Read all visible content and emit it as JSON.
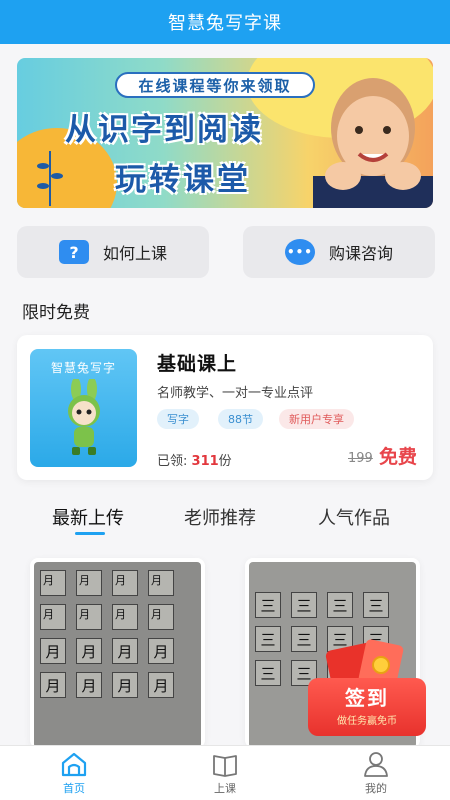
{
  "header": {
    "title": "智慧兔写字课"
  },
  "banner": {
    "subtitle": "在线课程等你来领取",
    "line1": "从识字到阅读",
    "line2": "玩转课堂",
    "page_count": 4,
    "active_page": 1
  },
  "quick_actions": [
    {
      "label": "如何上课",
      "icon": "question-icon"
    },
    {
      "label": "购课咨询",
      "icon": "chat-icon"
    }
  ],
  "section": {
    "title": "限时免费"
  },
  "course": {
    "thumb_text": "智慧兔写字",
    "title": "基础课上",
    "desc": "名师教学、一对一专业点评",
    "tags": [
      "写字",
      "88节",
      "新用户专享"
    ],
    "claimed_prefix": "已领:",
    "claimed_num": "311",
    "claimed_suffix": "份",
    "original_price": "199",
    "price_label": "免费"
  },
  "tabs": [
    "最新上传",
    "老师推荐",
    "人气作品"
  ],
  "cards": {
    "left_char": "月",
    "right_char": "三"
  },
  "gift": {
    "title": "签到",
    "subtitle": "做任务赢免币"
  },
  "bottom_nav": [
    {
      "label": "首页",
      "icon": "home-icon"
    },
    {
      "label": "上课",
      "icon": "book-icon"
    },
    {
      "label": "我的",
      "icon": "user-icon"
    }
  ],
  "colors": {
    "primary": "#1ea1f1",
    "price_red": "#e8454b",
    "tag_red": "#e05a5a"
  }
}
